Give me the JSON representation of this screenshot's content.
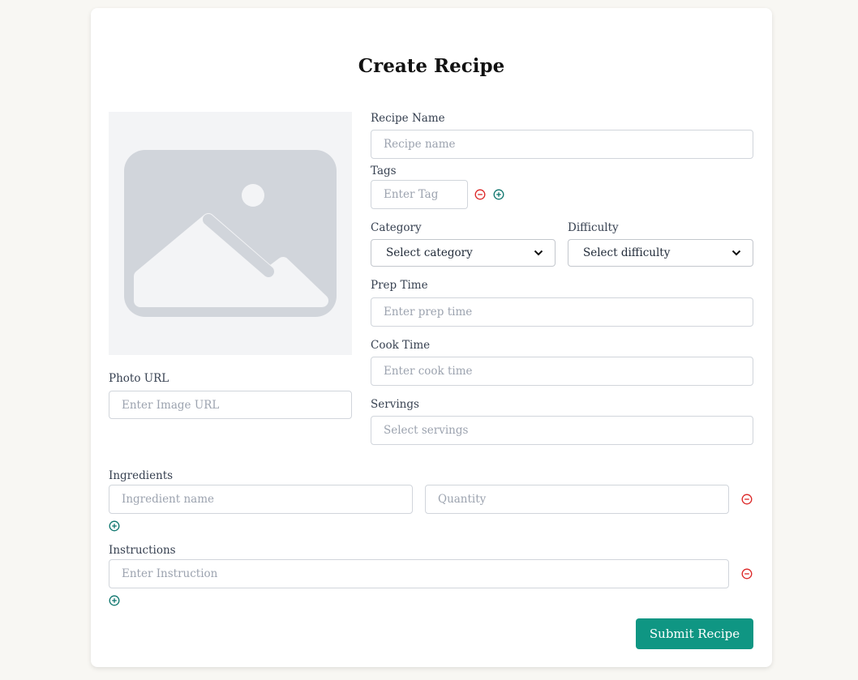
{
  "page": {
    "title": "Create Recipe"
  },
  "photo": {
    "label": "Photo URL",
    "placeholder": "Enter Image URL"
  },
  "recipe_name": {
    "label": "Recipe Name",
    "placeholder": "Recipe name"
  },
  "tags": {
    "label": "Tags",
    "placeholder": "Enter Tag"
  },
  "category": {
    "label": "Category",
    "selected": "Select category"
  },
  "difficulty": {
    "label": "Difficulty",
    "selected": "Select difficulty"
  },
  "prep_time": {
    "label": "Prep Time",
    "placeholder": "Enter prep time"
  },
  "cook_time": {
    "label": "Cook Time",
    "placeholder": "Enter cook time"
  },
  "servings": {
    "label": "Servings",
    "placeholder": "Select servings"
  },
  "ingredients": {
    "label": "Ingredients",
    "name_placeholder": "Ingredient name",
    "quantity_placeholder": "Quantity"
  },
  "instructions": {
    "label": "Instructions",
    "placeholder": "Enter Instruction"
  },
  "submit": {
    "label": "Submit Recipe"
  },
  "icons": {
    "remove": "minus-circle-icon",
    "add": "plus-circle-icon",
    "placeholder": "image-placeholder-icon",
    "dropdown": "chevron-down-icon"
  },
  "colors": {
    "accent": "#0f9683",
    "remove": "#dc2626",
    "add": "#0f766e",
    "background": "#f8f7f3"
  }
}
